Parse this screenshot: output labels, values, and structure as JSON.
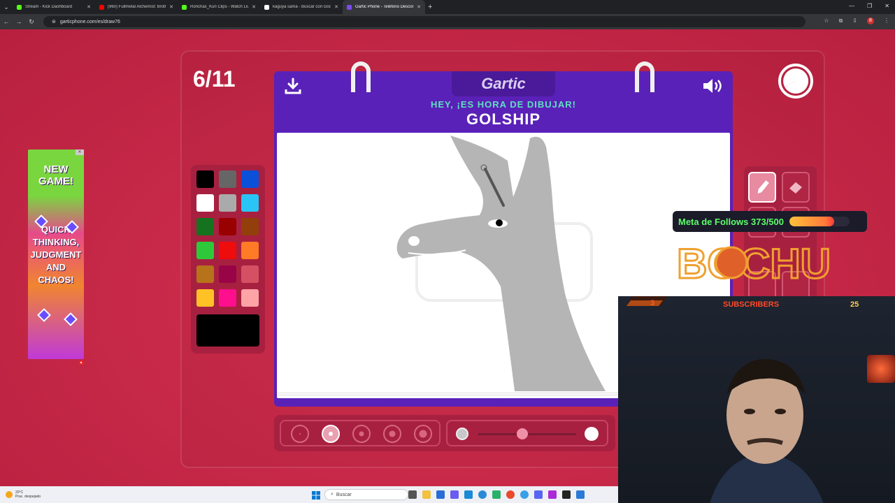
{
  "browser": {
    "tabs": [
      {
        "title": "Stream - Kick Dashboard",
        "color": "#53fc18",
        "active": false
      },
      {
        "title": "(960) Fullmetal Alchemist: Broth",
        "color": "#ff0000",
        "active": false
      },
      {
        "title": "Ronchas_Kun Clips - Watch Live",
        "color": "#53fc18",
        "active": false
      },
      {
        "title": "kaguya sama - Buscar con Goo",
        "color": "#ffffff",
        "active": false
      },
      {
        "title": "Gartic Phone - Teléfono Descon",
        "color": "#7a4cf0",
        "active": true
      }
    ],
    "new_tab": "+",
    "url": "garticphone.com/es/draw76",
    "profile_initial": "8"
  },
  "game": {
    "round_counter": "6/11",
    "logo": "Gartic",
    "prompt_heading": "HEY, ¡ES HORA DE DIBUJAR!",
    "prompt_word": "GOLSHIP",
    "palette_colors": [
      "#000000",
      "#666666",
      "#0a50d8",
      "#ffffff",
      "#aaaaaa",
      "#29c5f6",
      "#15731f",
      "#990000",
      "#923f0c",
      "#2dc93a",
      "#ee0c0c",
      "#ff7b25",
      "#b7721c",
      "#990447",
      "#d45164",
      "#ffc125",
      "#ff0e8e",
      "#fea4a7"
    ],
    "selected_color": "#000000",
    "brush_sizes": 5,
    "selected_brush_index": 1,
    "opacity_fraction": 0.45
  },
  "ad": {
    "headline": "NEW GAME!",
    "tagline": "QUICK THINKING, JUDGMENT AND CHAOS!"
  },
  "stream": {
    "follow_goal_label": "Meta de Follows 373/500",
    "follow_goal_fraction": 0.746,
    "brand": "BOCHU",
    "subs_count": "3",
    "subs_label": "SUBSCRIBERS",
    "subs_goal": "25"
  },
  "taskbar": {
    "temperature": "20°C",
    "weather": "Prac. despejado",
    "search_placeholder": "Buscar"
  }
}
